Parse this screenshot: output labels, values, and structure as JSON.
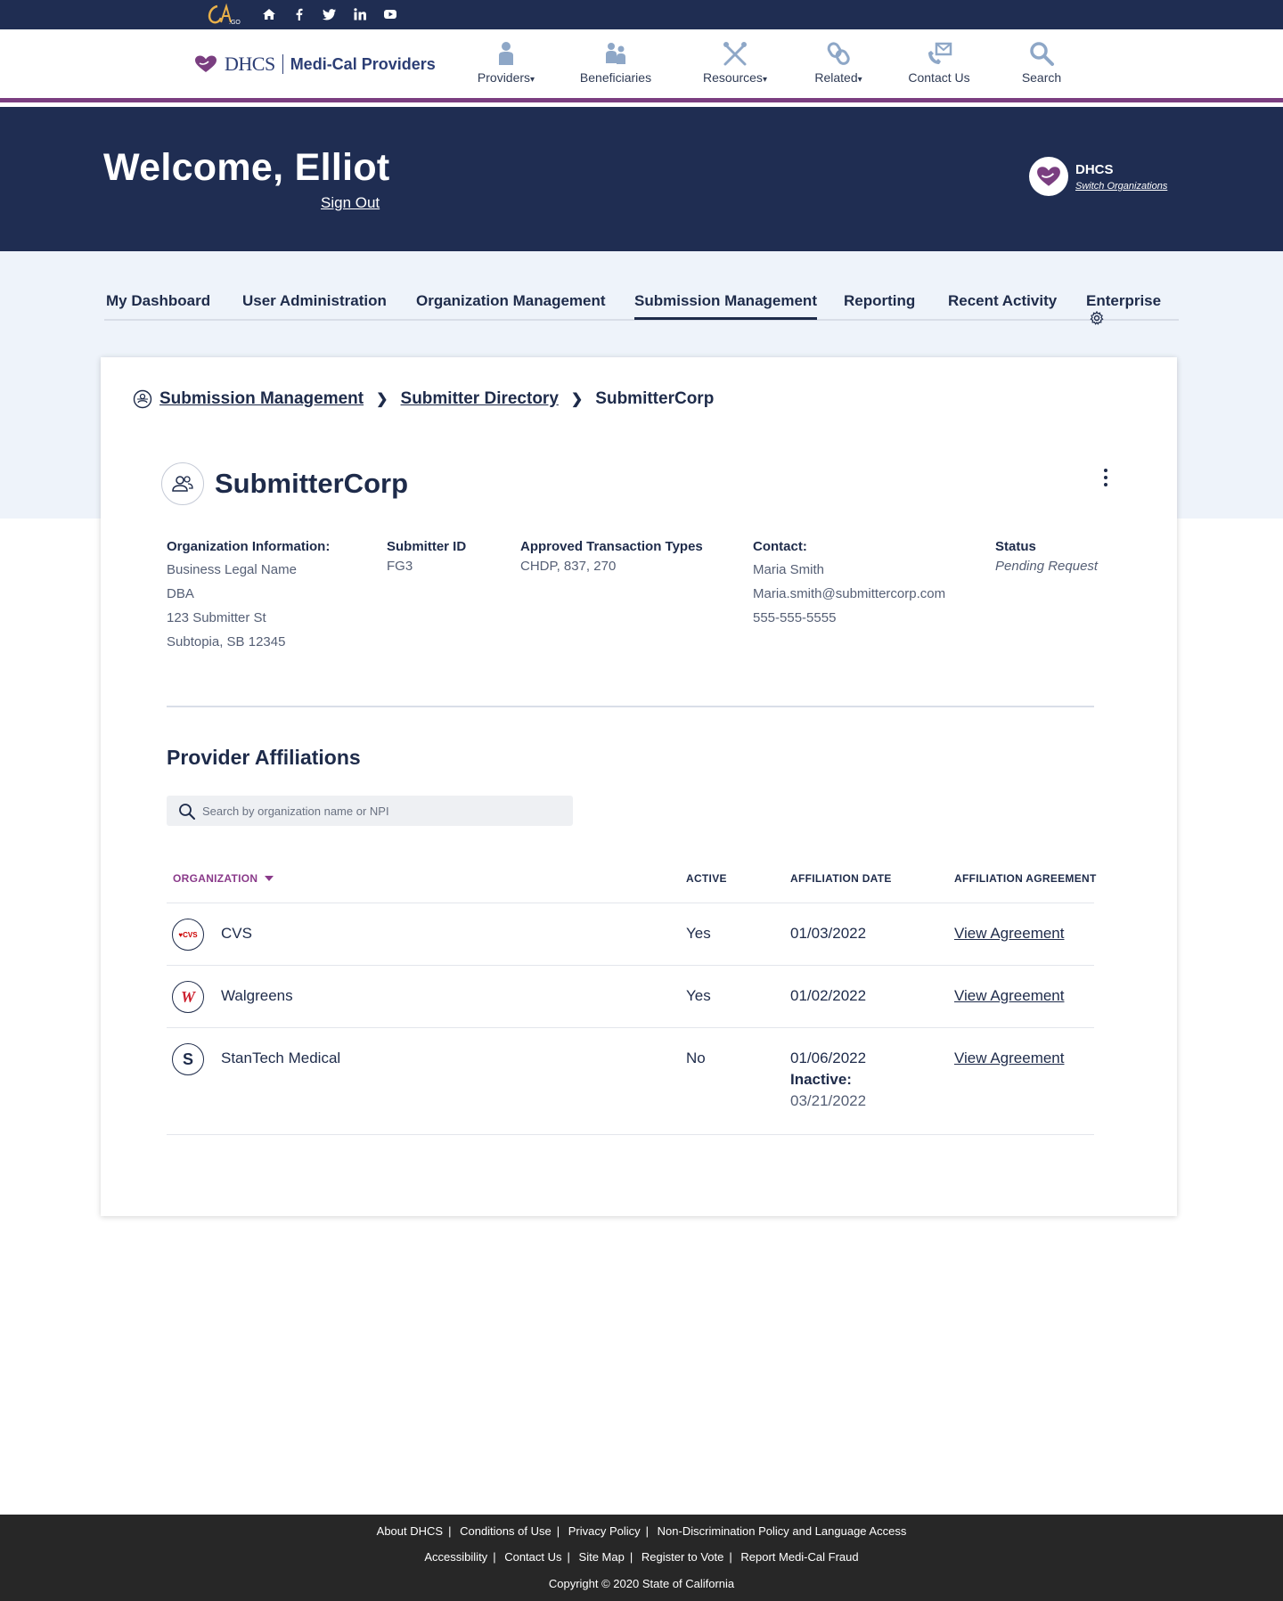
{
  "topbar": {
    "social_icons": [
      "home-icon",
      "facebook-icon",
      "twitter-icon",
      "linkedin-icon",
      "youtube-icon"
    ]
  },
  "header": {
    "brand": {
      "abbr": "DHCS",
      "name": "Medi-Cal Providers"
    },
    "nav": [
      {
        "label": "Providers",
        "icon": "person-icon",
        "dropdown": true
      },
      {
        "label": "Beneficiaries",
        "icon": "people-icon",
        "dropdown": false
      },
      {
        "label": "Resources",
        "icon": "tools-icon",
        "dropdown": true
      },
      {
        "label": "Related",
        "icon": "link-icon",
        "dropdown": true
      },
      {
        "label": "Contact Us",
        "icon": "contact-icon",
        "dropdown": false
      },
      {
        "label": "Search",
        "icon": "search-icon",
        "dropdown": false
      }
    ]
  },
  "banner": {
    "welcome": "Welcome, Elliot",
    "sign_out": "Sign Out",
    "org_name": "DHCS",
    "switch_org": "Switch Organizations"
  },
  "tabs": [
    {
      "label": "My Dashboard",
      "active": false
    },
    {
      "label": "User Administration",
      "active": false
    },
    {
      "label": "Organization Management",
      "active": false
    },
    {
      "label": "Submission Management",
      "active": true
    },
    {
      "label": "Reporting",
      "active": false
    },
    {
      "label": "Recent Activity",
      "active": false
    },
    {
      "label": "Enterprise",
      "active": false
    }
  ],
  "breadcrumb": {
    "items": [
      "Submission Management",
      "Submitter Directory"
    ],
    "current": "SubmitterCorp"
  },
  "org": {
    "title": "SubmitterCorp",
    "info_label": "Organization Information:",
    "info_lines": [
      "Business Legal Name",
      "DBA",
      "123 Submitter St",
      "Subtopia, SB 12345"
    ],
    "submitter_id_label": "Submitter ID",
    "submitter_id": "FG3",
    "transaction_label": "Approved Transaction Types",
    "transaction_types": "CHDP, 837, 270",
    "contact_label": "Contact:",
    "contact_name": "Maria Smith",
    "contact_email": "Maria.smith@submittercorp.com",
    "contact_phone": "555-555-5555",
    "status_label": "Status",
    "status": "Pending Request"
  },
  "affiliations": {
    "title": "Provider Affiliations",
    "search_placeholder": "Search by organization name or NPI",
    "columns": {
      "organization": "ORGANIZATION",
      "active": "ACTIVE",
      "date": "AFFILIATION DATE",
      "agreement": "AFFILIATION AGREEMENT"
    },
    "rows": [
      {
        "name": "CVS",
        "logo": "cvs-logo-icon",
        "active": "Yes",
        "date": "01/03/2022",
        "agreement": "View Agreement"
      },
      {
        "name": "Walgreens",
        "logo": "walgreens-logo-icon",
        "active": "Yes",
        "date": "01/02/2022",
        "agreement": "View Agreement"
      },
      {
        "name": "StanTech Medical",
        "logo": "stantech-logo-icon",
        "active": "No",
        "date": "01/06/2022",
        "inactive_label": "Inactive:",
        "inactive_date": "03/21/2022",
        "agreement": "View Agreement"
      }
    ],
    "logo_text": {
      "cvs": "♥CVS",
      "walgreens": "W",
      "stantech": "S"
    }
  },
  "footer": {
    "row1": [
      "About DHCS",
      "Conditions of Use",
      "Privacy Policy",
      "Non-Discrimination Policy and Language Access"
    ],
    "row2": [
      "Accessibility",
      "Contact Us",
      "Site Map",
      "Register to Vote",
      "Report Medi-Cal Fraud"
    ],
    "copyright": "Copyright © 2020 State of California"
  },
  "colors": {
    "navy": "#1f2d52",
    "accent_purple": "#7a3e80",
    "sort_purple": "#8a3a8a",
    "light_bg": "#eef3fa",
    "footer_bg": "#272727"
  }
}
